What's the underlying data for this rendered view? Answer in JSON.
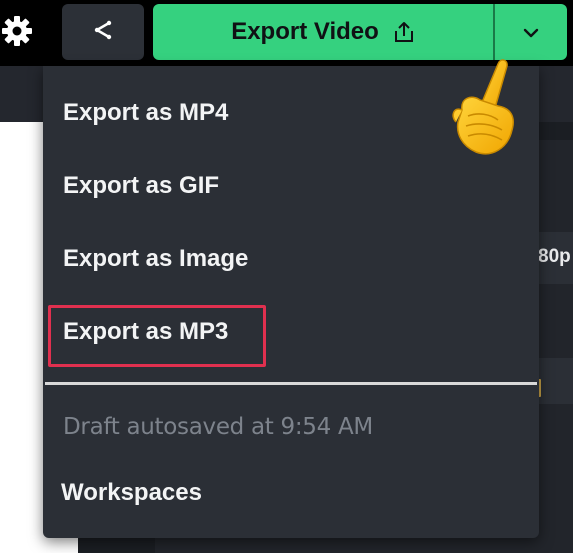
{
  "toolbar": {
    "export_label": "Export Video",
    "share_icon": "share-icon",
    "settings_icon": "gear-icon",
    "dropdown_icon": "chevron-down-icon",
    "export_icon": "upload-icon"
  },
  "export_menu": {
    "items": [
      {
        "label": "Export as MP4"
      },
      {
        "label": "Export as GIF"
      },
      {
        "label": "Export as Image"
      },
      {
        "label": "Export as MP3",
        "highlighted": true
      }
    ],
    "status": "Draft autosaved at 9:54 AM",
    "workspaces_label": "Workspaces"
  },
  "background": {
    "resolution_fragment": "80p"
  },
  "colors": {
    "accent_green": "#35d17f",
    "menu_bg": "#2b2f36",
    "highlight_border": "#e0304f",
    "muted_text": "#7d838c"
  },
  "cursor": "pointing-hand"
}
